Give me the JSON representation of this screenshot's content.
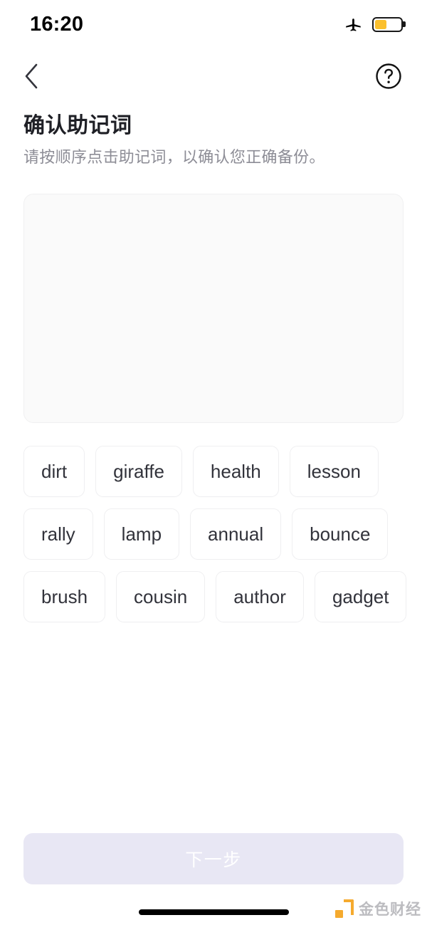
{
  "status_bar": {
    "time": "16:20",
    "airplane_icon": "airplane-mode-icon",
    "battery_icon": "battery-low-power-icon",
    "battery_level_percent": 45,
    "battery_fill_color": "#FBC02D"
  },
  "nav_bar": {
    "back_icon": "chevron-left-icon",
    "help_icon": "question-mark-circle-icon"
  },
  "header": {
    "title": "确认助记词",
    "subtitle": "请按顺序点击助记词，以确认您正确备份。"
  },
  "answer_area": {
    "selected_words": [],
    "background_color": "#FAFAFA",
    "border_color": "#F0F0F1"
  },
  "word_pool": {
    "words": [
      "dirt",
      "giraffe",
      "health",
      "lesson",
      "rally",
      "lamp",
      "annual",
      "bounce",
      "brush",
      "cousin",
      "author",
      "gadget"
    ]
  },
  "footer": {
    "next_label": "下一步",
    "next_enabled": false,
    "next_bg_color": "#E8E7F4",
    "next_text_color": "#FFFFFF"
  },
  "watermark": {
    "text": "金色财经",
    "accent_color": "#F5A623"
  }
}
